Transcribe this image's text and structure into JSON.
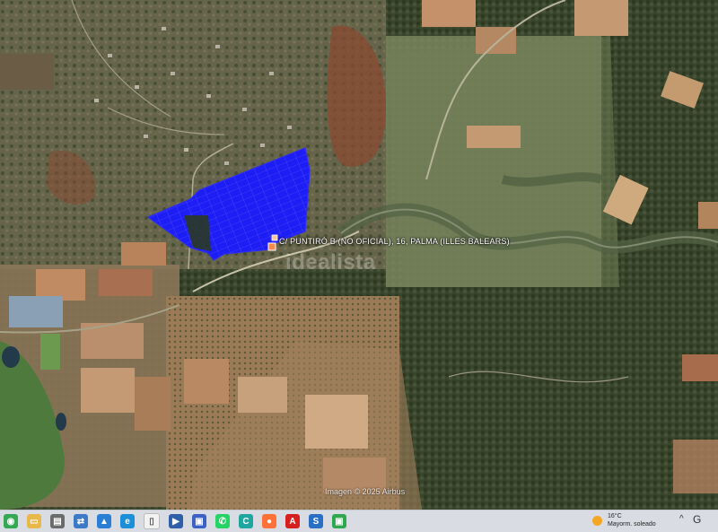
{
  "map": {
    "pin_label": "C/ PUNTIRÓ B (NO OFICIAL), 16, PALMA (ILLES BALEARS)",
    "watermark": "idealista",
    "copyright": "Imagen © 2025 Airbus",
    "parcel_color": "#1a1aff",
    "pin_color": "#f58a4b"
  },
  "taskbar": {
    "icons": [
      {
        "name": "chrome-icon",
        "color": "#34a853",
        "glyph": "◉"
      },
      {
        "name": "file-explorer-icon",
        "color": "#e8b84a",
        "glyph": "▭"
      },
      {
        "name": "printer-icon",
        "color": "#6b6b6b",
        "glyph": "▤"
      },
      {
        "name": "network-icon",
        "color": "#3c7ac8",
        "glyph": "⇄"
      },
      {
        "name": "photos-icon",
        "color": "#2a7fd4",
        "glyph": "▲"
      },
      {
        "name": "edge-icon",
        "color": "#1b8fd8",
        "glyph": "e"
      },
      {
        "name": "document-icon",
        "color": "#f2f2f2",
        "glyph": "▯"
      },
      {
        "name": "media-player-icon",
        "color": "#2e5fa8",
        "glyph": "▶"
      },
      {
        "name": "save-icon",
        "color": "#3b62c6",
        "glyph": "▣"
      },
      {
        "name": "whatsapp-icon",
        "color": "#25d366",
        "glyph": "✆"
      },
      {
        "name": "app-c-icon",
        "color": "#1fa6a0",
        "glyph": "C"
      },
      {
        "name": "firefox-icon",
        "color": "#ff7139",
        "glyph": "●"
      },
      {
        "name": "acrobat-icon",
        "color": "#d62020",
        "glyph": "A"
      },
      {
        "name": "app-s-icon",
        "color": "#2a6fc6",
        "glyph": "S"
      },
      {
        "name": "app-image-icon",
        "color": "#2fa84f",
        "glyph": "▣"
      }
    ],
    "weather": {
      "temp": "16°C",
      "desc": "Mayorm. soleado"
    },
    "tray_icon": "caret-up-icon",
    "tray_glyph": "^",
    "tray_letter": "G"
  }
}
